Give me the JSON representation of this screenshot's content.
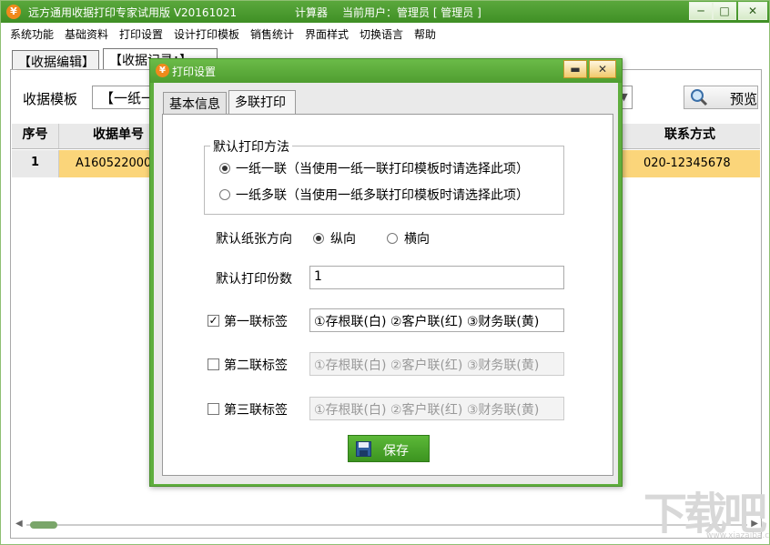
{
  "app": {
    "icon_text": "¥",
    "title": "远方通用收据打印专家试用版 V20161021",
    "calculator": "计算器",
    "current_user": "当前用户：管理员 [ 管理员 ]",
    "minimize": "─",
    "maximize": "□",
    "close": "✕"
  },
  "menu": [
    "系统功能",
    "基础资料",
    "打印设置",
    "设计打印模板",
    "销售统计",
    "界面样式",
    "切换语言",
    "帮助"
  ],
  "tabs": [
    "【收据编辑】",
    "【收据记录：】"
  ],
  "template": {
    "label": "收据模板",
    "value": "【一纸一",
    "dropdown_arrow": "▼",
    "preview": "预览"
  },
  "grid": {
    "headers": [
      "序号",
      "收据单号",
      "联系方式"
    ],
    "rows": [
      {
        "num": "1",
        "receipt_no": "A160522000",
        "contact": "020-12345678"
      }
    ]
  },
  "scroll": {
    "left": "◀",
    "right": "▶"
  },
  "watermark": {
    "main": "下载吧",
    "sub": "www.xiazaiba.com"
  },
  "dialog": {
    "icon_text": "¥",
    "title": "打印设置",
    "minimize": "▬",
    "close": "✕",
    "tabs": [
      "基本信息",
      "多联打印"
    ],
    "method_legend": "默认打印方法",
    "method_opt1": "一纸一联（当使用一纸一联打印模板时请选择此项）",
    "method_opt2": "一纸多联（当使用一纸多联打印模板时请选择此项）",
    "paper_label": "默认纸张方向",
    "portrait": "纵向",
    "landscape": "横向",
    "copies_label": "默认打印份数",
    "copies_value": "1",
    "label1": "第一联标签",
    "label1_value": "①存根联(白) ②客户联(红) ③财务联(黄)",
    "label1_checked": "✓",
    "label2": "第二联标签",
    "label2_value": "①存根联(白) ②客户联(红) ③财务联(黄)",
    "label3": "第三联标签",
    "label3_value": "①存根联(白) ②客户联(红) ③财务联(黄)",
    "save": "保存"
  }
}
